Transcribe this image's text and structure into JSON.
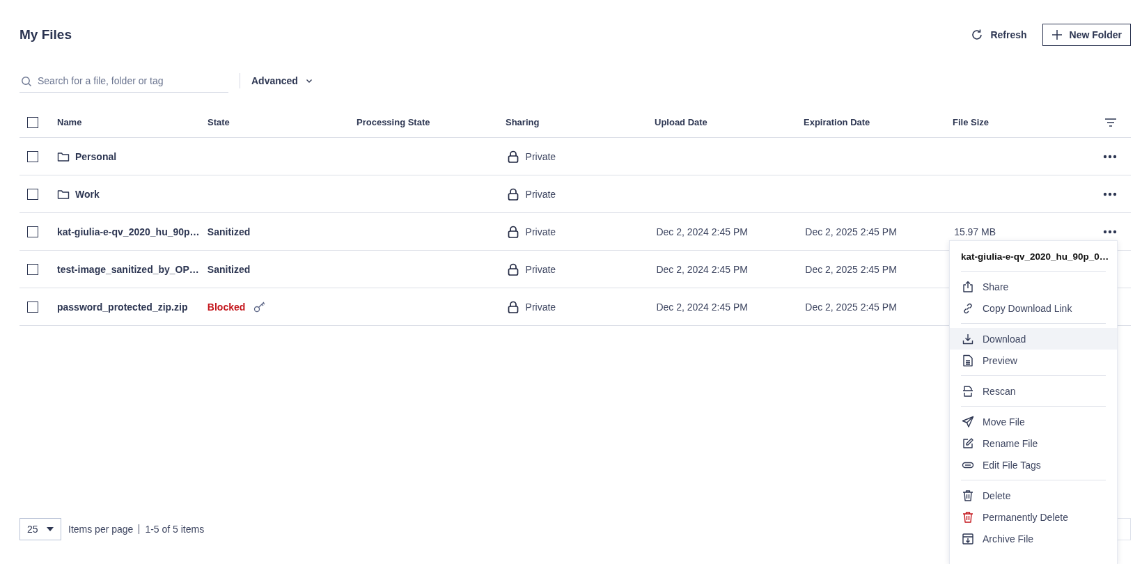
{
  "page": {
    "title": "My Files"
  },
  "actions": [
    {
      "kind": "refresh",
      "label": "Refresh"
    },
    {
      "kind": "new",
      "label": "New Folder"
    }
  ],
  "search": {
    "placeholder": "Search for a file, folder or tag"
  },
  "advanced": {
    "label": "Advanced"
  },
  "table": {
    "select_all": {
      "checked": false
    },
    "columns": [
      "Name",
      "State",
      "Processing State",
      "Sharing",
      "Upload Date",
      "Expiration Date",
      "File Size"
    ],
    "rows": [
      {
        "kind": "folder",
        "checked": false,
        "name": "Personal",
        "sharing": "Private"
      },
      {
        "kind": "folder",
        "checked": false,
        "name": "Work",
        "sharing": "Private"
      },
      {
        "kind": "file",
        "checked": false,
        "name": "kat-giulia-e-qv_2020_hu_90p…",
        "state": "Sanitized",
        "blocked": false,
        "password": false,
        "sharing": "Private",
        "upload": "Dec 2, 2024 2:45 PM",
        "expiration": "Dec 2, 2025 2:45 PM",
        "size": "15.97 MB"
      },
      {
        "kind": "file",
        "checked": false,
        "name": "test-image_sanitized_by_OP…",
        "state": "Sanitized",
        "blocked": false,
        "password": false,
        "sharing": "Private",
        "upload": "Dec 2, 2024 2:45 PM",
        "expiration": "Dec 2, 2025 2:45 PM"
      },
      {
        "kind": "file",
        "checked": false,
        "name": "password_protected_zip.zip",
        "state": "Blocked",
        "blocked": true,
        "password": true,
        "sharing": "Private",
        "upload": "Dec 2, 2024 2:45 PM",
        "expiration": "Dec 2, 2025 2:45 PM"
      }
    ]
  },
  "pagination": {
    "per_page": "25",
    "label": "Items per page",
    "range": "1-5 of 5 items"
  },
  "context_menu": {
    "title": "kat-giulia-e-qv_2020_hu_90p_0…",
    "sections": [
      [
        {
          "kind": "share",
          "label": "Share",
          "selected": false,
          "danger": false
        },
        {
          "kind": "link",
          "label": "Copy Download Link",
          "selected": false,
          "danger": false
        }
      ],
      [
        {
          "kind": "download",
          "label": "Download",
          "selected": true,
          "danger": false
        },
        {
          "kind": "preview",
          "label": "Preview",
          "selected": false,
          "danger": false
        }
      ],
      [
        {
          "kind": "rescan",
          "label": "Rescan",
          "selected": false,
          "danger": false
        }
      ],
      [
        {
          "kind": "move",
          "label": "Move File",
          "selected": false,
          "danger": false
        },
        {
          "kind": "rename",
          "label": "Rename File",
          "selected": false,
          "danger": false
        },
        {
          "kind": "tags",
          "label": "Edit File Tags",
          "selected": false,
          "danger": false
        }
      ],
      [
        {
          "kind": "delete",
          "label": "Delete",
          "selected": false,
          "danger": false
        },
        {
          "kind": "delete",
          "label": "Permanently Delete",
          "selected": false,
          "danger": true
        },
        {
          "kind": "archive",
          "label": "Archive File",
          "selected": false,
          "danger": false
        }
      ]
    ]
  }
}
